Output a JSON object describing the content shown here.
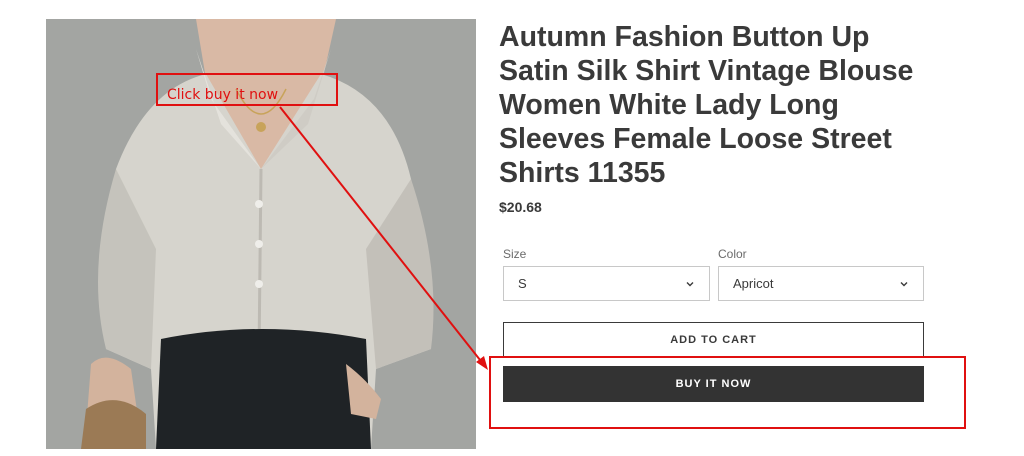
{
  "product": {
    "title": "Autumn Fashion Button Up Satin Silk Shirt Vintage Blouse Women White Lady Long Sleeves Female Loose Street Shirts 11355",
    "price": "$20.68",
    "image_icon": "product-photo-satin-shirt"
  },
  "options": {
    "size": {
      "label": "Size",
      "value": "S"
    },
    "color": {
      "label": "Color",
      "value": "Apricot"
    }
  },
  "buttons": {
    "add_to_cart": "ADD TO CART",
    "buy_it_now": "BUY IT NOW"
  },
  "annotation": {
    "text": "Click buy it now",
    "color": "#e01010"
  }
}
